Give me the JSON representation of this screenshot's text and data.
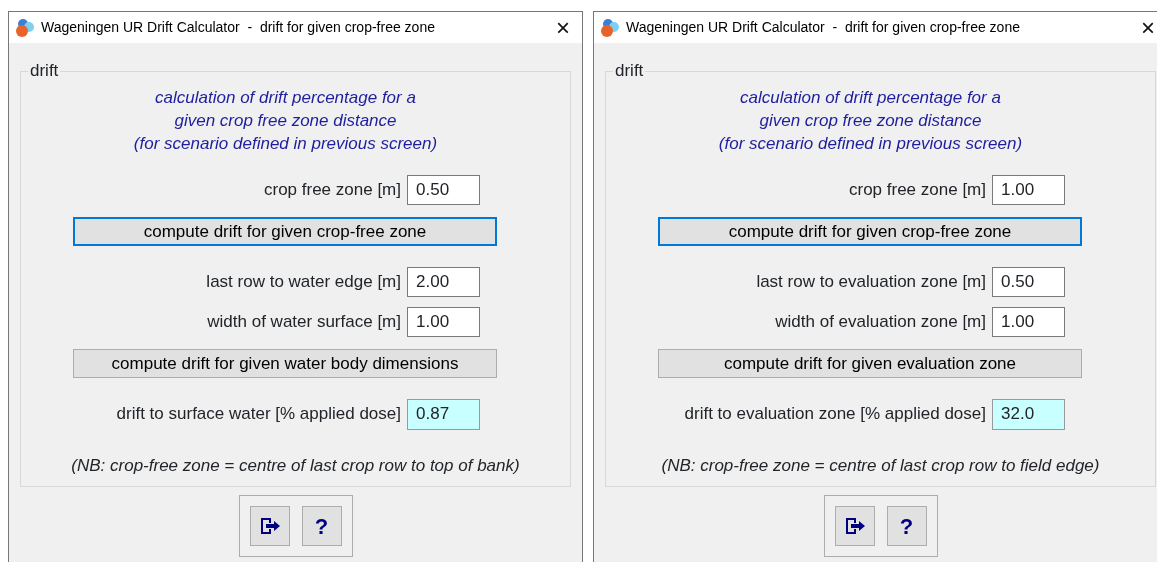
{
  "windows": [
    {
      "title": "Wageningen UR Drift Calculator  -  drift for given crop-free zone",
      "close": "×",
      "group_label": "drift",
      "intro": [
        "calculation of drift percentage for a",
        "given crop free zone distance",
        "(for scenario defined in previous screen)"
      ],
      "rows": [
        {
          "kind": "field",
          "label": "crop free zone [m]",
          "value": "0.50"
        },
        {
          "kind": "button",
          "label": "compute drift for given crop-free zone",
          "focused": true
        },
        {
          "kind": "field",
          "label": "last row to water edge [m]",
          "value": "2.00"
        },
        {
          "kind": "field",
          "label": "width of water surface [m]",
          "value": "1.00"
        },
        {
          "kind": "button",
          "label": "compute drift for given water body dimensions",
          "focused": false
        },
        {
          "kind": "output",
          "label": "drift to surface water [% applied dose]",
          "value": "0.87"
        }
      ],
      "note": "(NB: crop-free zone = centre of last crop row to top of bank)",
      "help": "?"
    },
    {
      "title": "Wageningen UR Drift Calculator  -  drift for given crop-free zone",
      "close": "×",
      "group_label": "drift",
      "intro": [
        "calculation of drift percentage for a",
        "given crop free zone distance",
        "(for scenario defined in previous screen)"
      ],
      "rows": [
        {
          "kind": "field",
          "label": "crop free zone [m]",
          "value": "1.00"
        },
        {
          "kind": "button",
          "label": "compute drift for given crop-free zone",
          "focused": true
        },
        {
          "kind": "field",
          "label": "last row to evaluation zone [m]",
          "value": "0.50"
        },
        {
          "kind": "field",
          "label": "width of evaluation zone [m]",
          "value": "1.00"
        },
        {
          "kind": "button",
          "label": "compute drift for given evaluation zone",
          "focused": false
        },
        {
          "kind": "output",
          "label": "drift to evaluation zone [% applied dose]",
          "value": "32.0"
        }
      ],
      "note": "(NB: crop-free zone = centre of last crop row to field edge)",
      "help": "?"
    }
  ]
}
